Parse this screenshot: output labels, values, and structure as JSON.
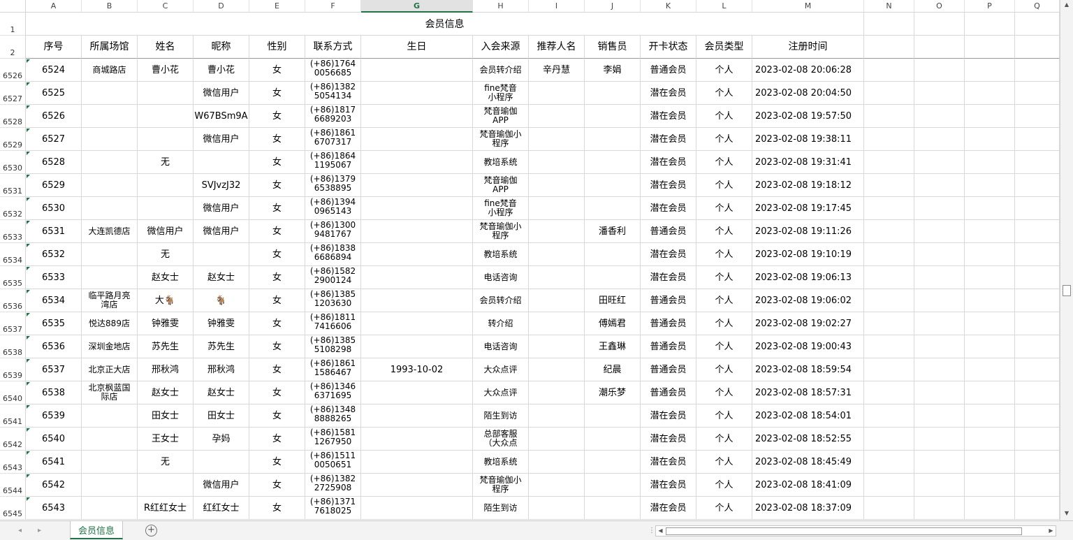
{
  "sheet": {
    "columns": [
      "A",
      "B",
      "C",
      "D",
      "E",
      "F",
      "G",
      "H",
      "I",
      "J",
      "K",
      "L",
      "M",
      "N",
      "O",
      "P",
      "Q"
    ],
    "selected_column": "G",
    "title_row_number": "1",
    "header_row_number": "2",
    "title": "会员信息",
    "headers": [
      "序号",
      "所属场馆",
      "姓名",
      "昵称",
      "性别",
      "联系方式",
      "生日",
      "入会来源",
      "推荐人名",
      "销售员",
      "开卡状态",
      "会员类型",
      "注册时间"
    ],
    "rows": [
      {
        "rownum": "6526",
        "cells": [
          "6524",
          "商城路店",
          "曹小花",
          "曹小花",
          "女",
          "(+86)1764\n0056685",
          "",
          "会员转介绍",
          "辛丹慧",
          "李娟",
          "普通会员",
          "个人",
          "2023-02-08 20:06:28"
        ]
      },
      {
        "rownum": "6527",
        "cells": [
          "6525",
          "",
          "",
          "微信用户",
          "女",
          "(+86)1382\n5054134",
          "",
          "fine梵音\n小程序",
          "",
          "",
          "潜在会员",
          "个人",
          "2023-02-08 20:04:50"
        ]
      },
      {
        "rownum": "6528",
        "cells": [
          "6526",
          "",
          "",
          "W67BSm9A",
          "女",
          "(+86)1817\n6689203",
          "",
          "梵音瑜伽\nAPP",
          "",
          "",
          "潜在会员",
          "个人",
          "2023-02-08 19:57:50"
        ]
      },
      {
        "rownum": "6529",
        "cells": [
          "6527",
          "",
          "",
          "微信用户",
          "女",
          "(+86)1861\n6707317",
          "",
          "梵音瑜伽小\n程序",
          "",
          "",
          "潜在会员",
          "个人",
          "2023-02-08 19:38:11"
        ]
      },
      {
        "rownum": "6530",
        "cells": [
          "6528",
          "",
          "无",
          "",
          "女",
          "(+86)1864\n1195067",
          "",
          "教培系统",
          "",
          "",
          "潜在会员",
          "个人",
          "2023-02-08 19:31:41"
        ]
      },
      {
        "rownum": "6531",
        "cells": [
          "6529",
          "",
          "",
          "SVJvzJ32",
          "女",
          "(+86)1379\n6538895",
          "",
          "梵音瑜伽\nAPP",
          "",
          "",
          "潜在会员",
          "个人",
          "2023-02-08 19:18:12"
        ]
      },
      {
        "rownum": "6532",
        "cells": [
          "6530",
          "",
          "",
          "微信用户",
          "女",
          "(+86)1394\n0965143",
          "",
          "fine梵音\n小程序",
          "",
          "",
          "潜在会员",
          "个人",
          "2023-02-08 19:17:45"
        ]
      },
      {
        "rownum": "6533",
        "cells": [
          "6531",
          "大连凯德店",
          "微信用户",
          "微信用户",
          "女",
          "(+86)1300\n9481767",
          "",
          "梵音瑜伽小\n程序",
          "",
          "潘香利",
          "普通会员",
          "个人",
          "2023-02-08 19:11:26"
        ]
      },
      {
        "rownum": "6534",
        "cells": [
          "6532",
          "",
          "无",
          "",
          "女",
          "(+86)1838\n6686894",
          "",
          "教培系统",
          "",
          "",
          "潜在会员",
          "个人",
          "2023-02-08 19:10:19"
        ]
      },
      {
        "rownum": "6535",
        "cells": [
          "6533",
          "",
          "赵女士",
          "赵女士",
          "女",
          "(+86)1582\n2900124",
          "",
          "电话咨询",
          "",
          "",
          "潜在会员",
          "个人",
          "2023-02-08 19:06:13"
        ]
      },
      {
        "rownum": "6536",
        "cells": [
          "6534",
          "临平路月亮\n湾店",
          "大🐐",
          "🐐",
          "女",
          "(+86)1385\n1203630",
          "",
          "会员转介绍",
          "",
          "田旺红",
          "普通会员",
          "个人",
          "2023-02-08 19:06:02"
        ]
      },
      {
        "rownum": "6537",
        "cells": [
          "6535",
          "悦达889店",
          "钟雅雯",
          "钟雅雯",
          "女",
          "(+86)1811\n7416606",
          "",
          "转介绍",
          "",
          "傅嫣君",
          "普通会员",
          "个人",
          "2023-02-08 19:02:27"
        ]
      },
      {
        "rownum": "6538",
        "cells": [
          "6536",
          "深圳金地店",
          "苏先生",
          "苏先生",
          "女",
          "(+86)1385\n5108298",
          "",
          "电话咨询",
          "",
          "王鑫琳",
          "普通会员",
          "个人",
          "2023-02-08 19:00:43"
        ]
      },
      {
        "rownum": "6539",
        "cells": [
          "6537",
          "北京正大店",
          "邢秋鸿",
          "邢秋鸿",
          "女",
          "(+86)1861\n1586467",
          "1993-10-02",
          "大众点评",
          "",
          "纪晨",
          "普通会员",
          "个人",
          "2023-02-08 18:59:54"
        ]
      },
      {
        "rownum": "6540",
        "cells": [
          "6538",
          "北京枫蓝国\n际店",
          "赵女士",
          "赵女士",
          "女",
          "(+86)1346\n6371695",
          "",
          "大众点评",
          "",
          "潮乐梦",
          "普通会员",
          "个人",
          "2023-02-08 18:57:31"
        ]
      },
      {
        "rownum": "6541",
        "cells": [
          "6539",
          "",
          "田女士",
          "田女士",
          "女",
          "(+86)1348\n8888265",
          "",
          "陌生到访",
          "",
          "",
          "潜在会员",
          "个人",
          "2023-02-08 18:54:01"
        ]
      },
      {
        "rownum": "6542",
        "cells": [
          "6540",
          "",
          "王女士",
          "孕妈",
          "女",
          "(+86)1581\n1267950",
          "",
          "总部客服\n（大众点",
          "",
          "",
          "潜在会员",
          "个人",
          "2023-02-08 18:52:55"
        ]
      },
      {
        "rownum": "6543",
        "cells": [
          "6541",
          "",
          "无",
          "",
          "女",
          "(+86)1511\n0050651",
          "",
          "教培系统",
          "",
          "",
          "潜在会员",
          "个人",
          "2023-02-08 18:45:49"
        ]
      },
      {
        "rownum": "6544",
        "cells": [
          "6542",
          "",
          "",
          "微信用户",
          "女",
          "(+86)1382\n2725908",
          "",
          "梵音瑜伽小\n程序",
          "",
          "",
          "潜在会员",
          "个人",
          "2023-02-08 18:41:09"
        ]
      },
      {
        "rownum": "6545",
        "cells": [
          "6543",
          "",
          "R红红女士",
          "红红女士",
          "女",
          "(+86)1371\n7618025",
          "",
          "陌生到访",
          "",
          "",
          "潜在会员",
          "个人",
          "2023-02-08 18:37:09"
        ]
      }
    ]
  },
  "footer": {
    "sheet_tab": "会员信息",
    "add_sheet": "+",
    "prev_arrow": "◂",
    "next_arrow": "▸"
  },
  "colors": {
    "accent": "#217346"
  }
}
